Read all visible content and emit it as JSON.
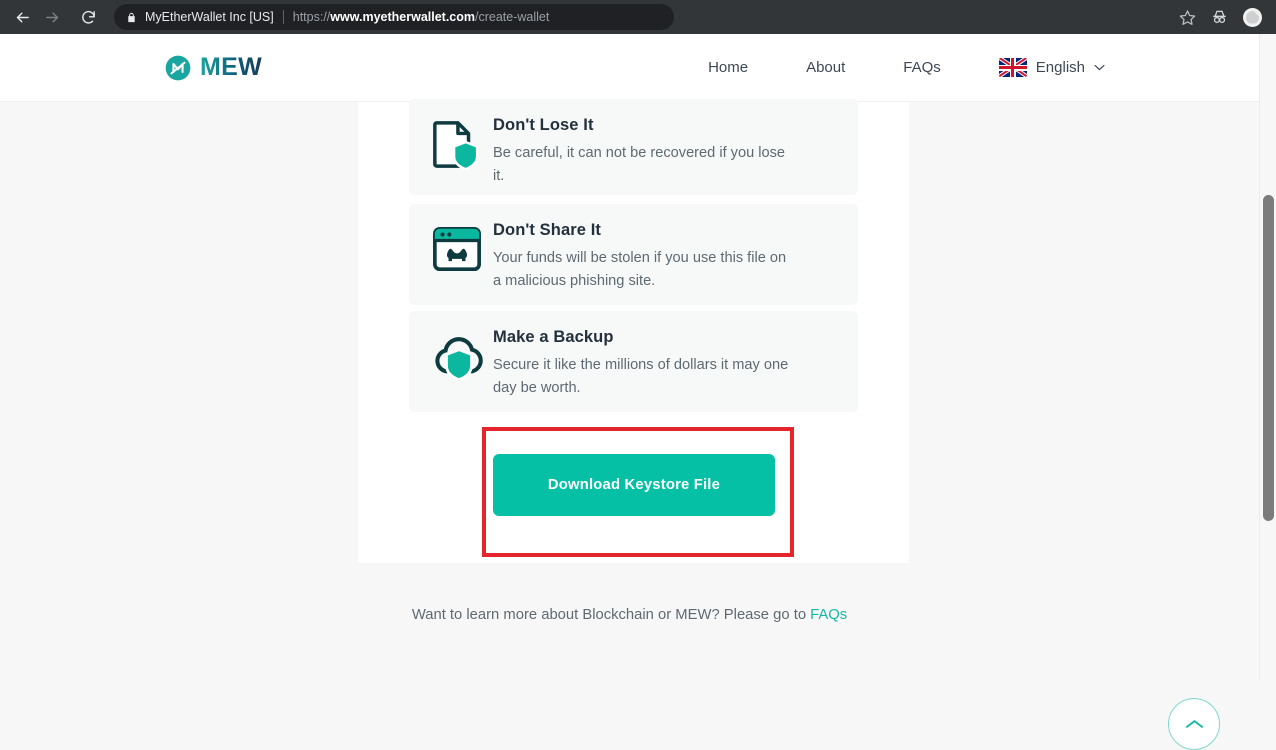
{
  "browser": {
    "back_icon": "back-arrow-icon",
    "forward_icon": "forward-arrow-icon",
    "reload_icon": "reload-icon",
    "lock_icon": "lock-icon",
    "site_identity": "MyEtherWallet Inc [US]",
    "url_scheme": "https://",
    "url_host": "www.myetherwallet.com",
    "url_path": "/create-wallet",
    "bookmark_icon": "star-icon",
    "incognito_icon": "incognito-icon",
    "profile_icon": "profile-avatar-icon"
  },
  "header": {
    "logo_text": "MEW",
    "logo_mark": "mew-logo-icon",
    "nav": [
      {
        "label": "Home"
      },
      {
        "label": "About"
      },
      {
        "label": "FAQs"
      }
    ],
    "language": {
      "flag": "uk-flag-icon",
      "label": "English",
      "chevron": "chevron-down-icon"
    }
  },
  "main": {
    "cards": [
      {
        "icon": "document-shield-icon",
        "title": "Don't Lose It",
        "description": "Be careful, it can not be recovered if you lose it."
      },
      {
        "icon": "phishing-site-icon",
        "title": "Don't Share It",
        "description": "Your funds will be stolen if you use this file on a malicious phishing site."
      },
      {
        "icon": "cloud-backup-shield-icon",
        "title": "Make a Backup",
        "description": "Secure it like the millions of dollars it may one day be worth."
      }
    ],
    "download_button_label": "Download Keystore File",
    "highlight_color": "#e4252c",
    "accent_color": "#05c0a5"
  },
  "footer": {
    "text_before": "Want to learn more about Blockchain or MEW? Please go to ",
    "link_label": "FAQs"
  },
  "scroll_top": {
    "icon": "chevron-up-icon"
  }
}
